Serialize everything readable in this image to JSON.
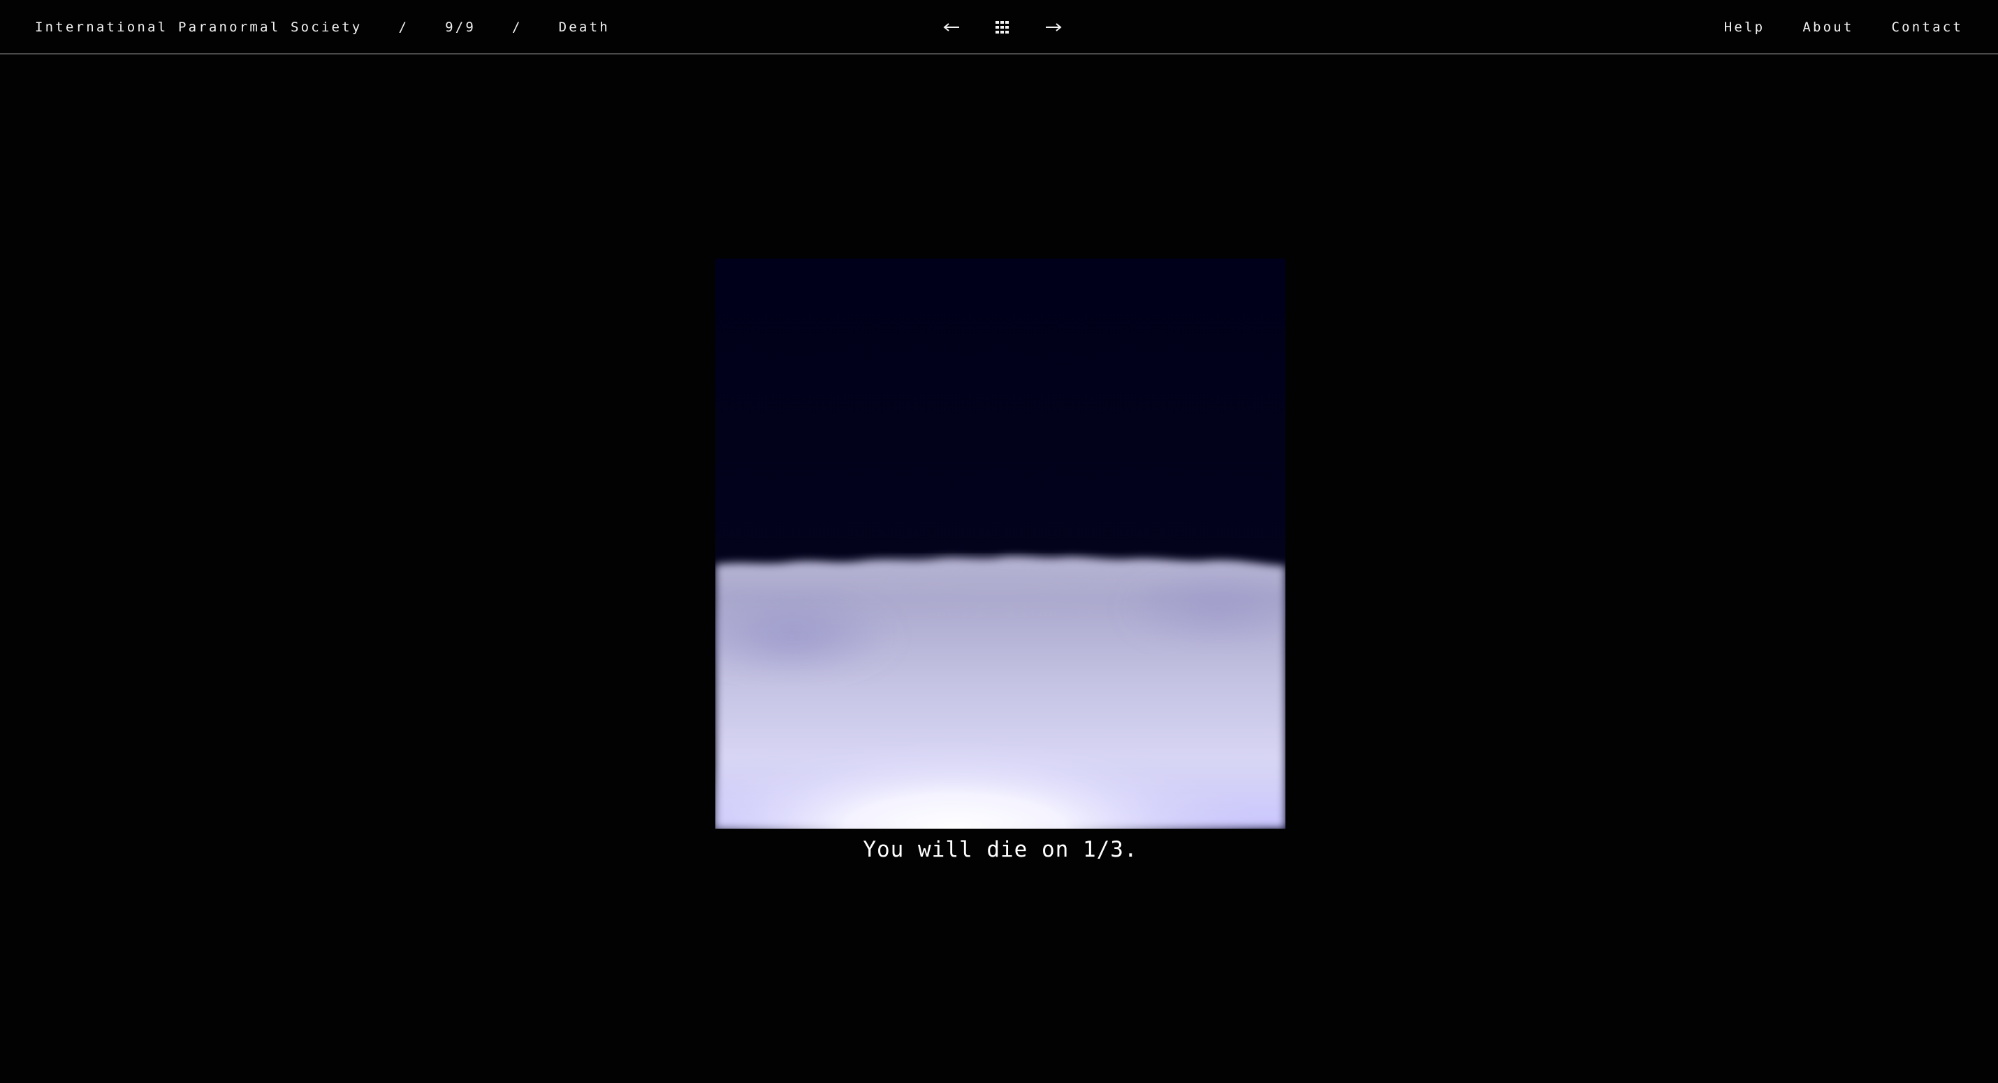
{
  "header": {
    "site_name": "International Paranormal Society",
    "separator": "/",
    "counter": "9/9",
    "page_title": "Death",
    "nav": {
      "prev_icon": "arrow-left-icon",
      "grid_icon": "grid-icon",
      "next_icon": "arrow-right-icon"
    },
    "links": [
      "Help",
      "About",
      "Contact"
    ]
  },
  "artwork": {
    "description_icon": "cloud-landscape-image"
  },
  "caption": "You will die on 1/3.",
  "colors": {
    "background": "#020202",
    "text": "#f2f2f2",
    "divider": "#4a4a4a",
    "sky": "#01011a",
    "cloud_glow": "#c9c6ff"
  }
}
